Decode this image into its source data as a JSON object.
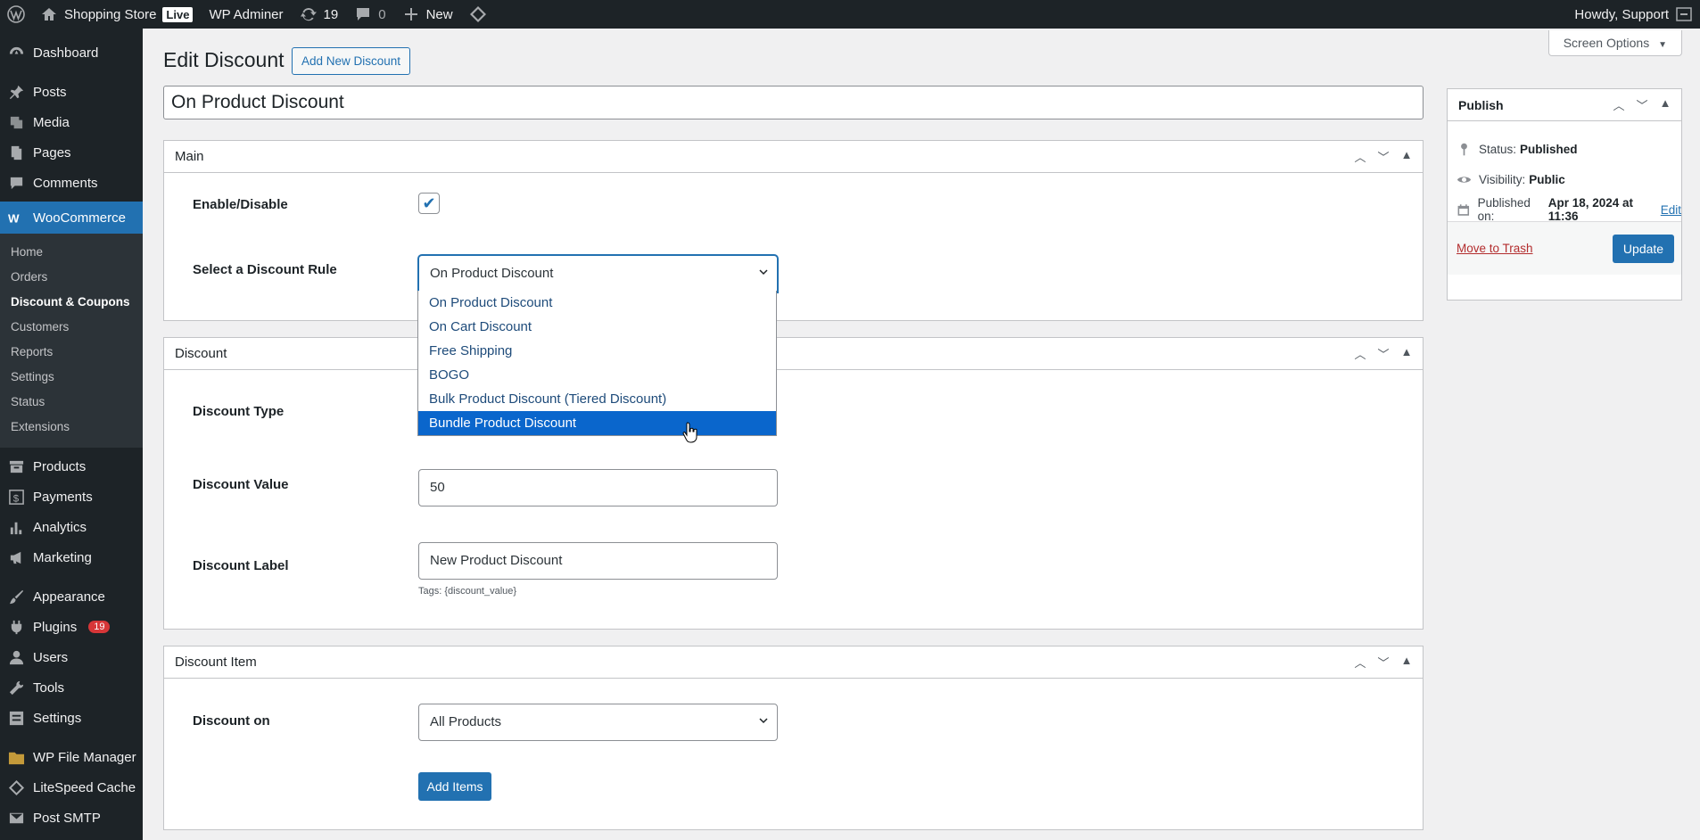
{
  "adminbar": {
    "site_name": "Shopping Store",
    "live_label": "Live",
    "admin_label": "WP Adminer",
    "updates_count": "19",
    "comments_count": "0",
    "new_label": "New",
    "howdy": "Howdy, Support"
  },
  "sidebar": {
    "dashboard": "Dashboard",
    "posts": "Posts",
    "media": "Media",
    "pages": "Pages",
    "comments": "Comments",
    "woocommerce": "WooCommerce",
    "woo_sub": [
      "Home",
      "Orders",
      "Discount & Coupons",
      "Customers",
      "Reports",
      "Settings",
      "Status",
      "Extensions"
    ],
    "products": "Products",
    "payments": "Payments",
    "analytics": "Analytics",
    "marketing": "Marketing",
    "appearance": "Appearance",
    "plugins": "Plugins",
    "plugins_badge": "19",
    "users": "Users",
    "tools": "Tools",
    "settings": "Settings",
    "file_manager": "WP File Manager",
    "litespeed": "LiteSpeed Cache",
    "post_smtp": "Post SMTP"
  },
  "header": {
    "screen_options": "Screen Options",
    "page_title": "Edit Discount",
    "add_new": "Add New Discount",
    "post_title": "On Product Discount"
  },
  "main_box": {
    "title": "Main",
    "enable_label": "Enable/Disable",
    "rule_label": "Select a Discount Rule",
    "rule_value": "On Product Discount",
    "rule_options": [
      "On Product Discount",
      "On Cart Discount",
      "Free Shipping",
      "BOGO",
      "Bulk Product Discount (Tiered Discount)",
      "Bundle Product Discount"
    ],
    "highlighted_option": "Bundle Product Discount"
  },
  "discount_box": {
    "title": "Discount",
    "type_label": "Discount Type",
    "value_label": "Discount Value",
    "value": "50",
    "label_label": "Discount Label",
    "label_value": "New Product Discount",
    "tags_hint": "Tags: {discount_value}"
  },
  "item_box": {
    "title": "Discount Item",
    "on_label": "Discount on",
    "on_value": "All Products",
    "add_items": "Add Items"
  },
  "publish": {
    "title": "Publish",
    "status_label": "Status:",
    "status_value": "Published",
    "visibility_label": "Visibility:",
    "visibility_value": "Public",
    "published_label": "Published on:",
    "published_value": "Apr 18, 2024 at 11:36",
    "edit": "Edit",
    "trash": "Move to Trash",
    "update": "Update"
  }
}
